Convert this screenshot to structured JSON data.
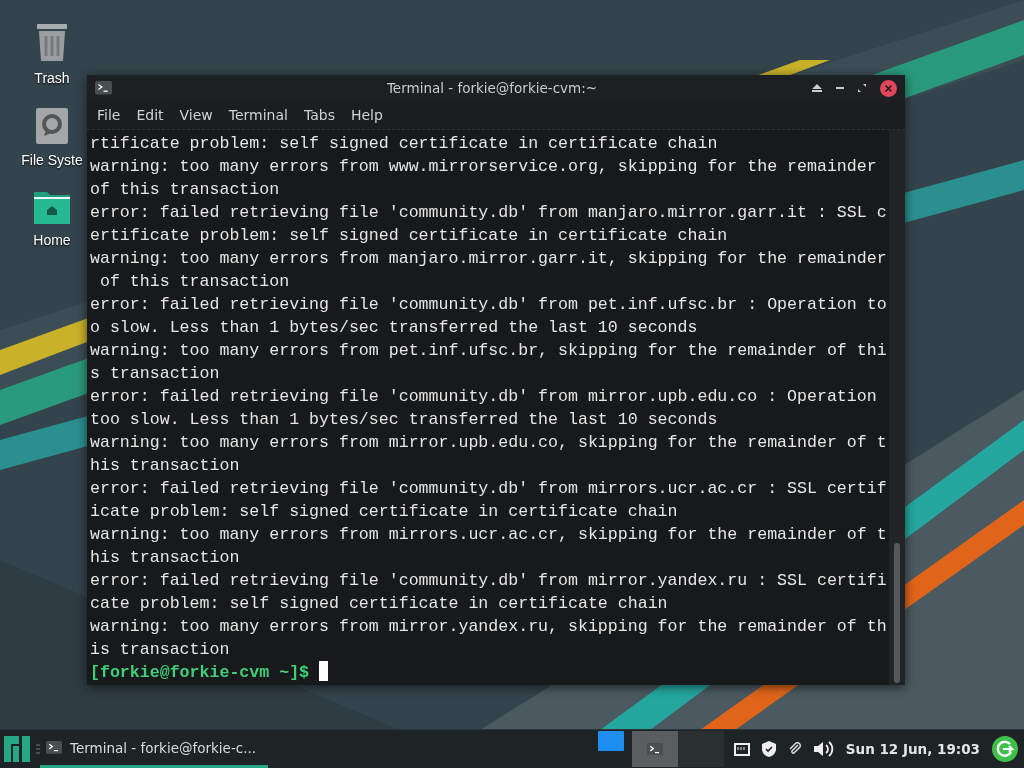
{
  "desktop_icons": [
    {
      "label": "Trash",
      "kind": "trash"
    },
    {
      "label": "File Syste",
      "kind": "drive"
    },
    {
      "label": "Home",
      "kind": "home"
    }
  ],
  "window": {
    "title": "Terminal - forkie@forkie-cvm:~",
    "menu": [
      "File",
      "Edit",
      "View",
      "Terminal",
      "Tabs",
      "Help"
    ],
    "lines": [
      "rtificate problem: self signed certificate in certificate chain",
      "warning: too many errors from www.mirrorservice.org, skipping for the remainder",
      "of this transaction",
      "error: failed retrieving file 'community.db' from manjaro.mirror.garr.it : SSL c",
      "ertificate problem: self signed certificate in certificate chain",
      "warning: too many errors from manjaro.mirror.garr.it, skipping for the remainder",
      " of this transaction",
      "error: failed retrieving file 'community.db' from pet.inf.ufsc.br : Operation to",
      "o slow. Less than 1 bytes/sec transferred the last 10 seconds",
      "warning: too many errors from pet.inf.ufsc.br, skipping for the remainder of thi",
      "s transaction",
      "error: failed retrieving file 'community.db' from mirror.upb.edu.co : Operation ",
      "too slow. Less than 1 bytes/sec transferred the last 10 seconds",
      "warning: too many errors from mirror.upb.edu.co, skipping for the remainder of t",
      "his transaction",
      "error: failed retrieving file 'community.db' from mirrors.ucr.ac.cr : SSL certif",
      "icate problem: self signed certificate in certificate chain",
      "warning: too many errors from mirrors.ucr.ac.cr, skipping for the remainder of t",
      "his transaction",
      "error: failed retrieving file 'community.db' from mirror.yandex.ru : SSL certifi",
      "cate problem: self signed certificate in certificate chain",
      "warning: too many errors from mirror.yandex.ru, skipping for the remainder of th",
      "is transaction"
    ],
    "prompt": "[forkie@forkie-cvm ~]$"
  },
  "taskbar": {
    "task": {
      "label": "Terminal - forkie@forkie-c...",
      "selected": true
    },
    "workspaces": [
      {
        "selected": true
      },
      {
        "selected": false
      }
    ],
    "clock": "Sun 12 Jun, 19:03"
  }
}
